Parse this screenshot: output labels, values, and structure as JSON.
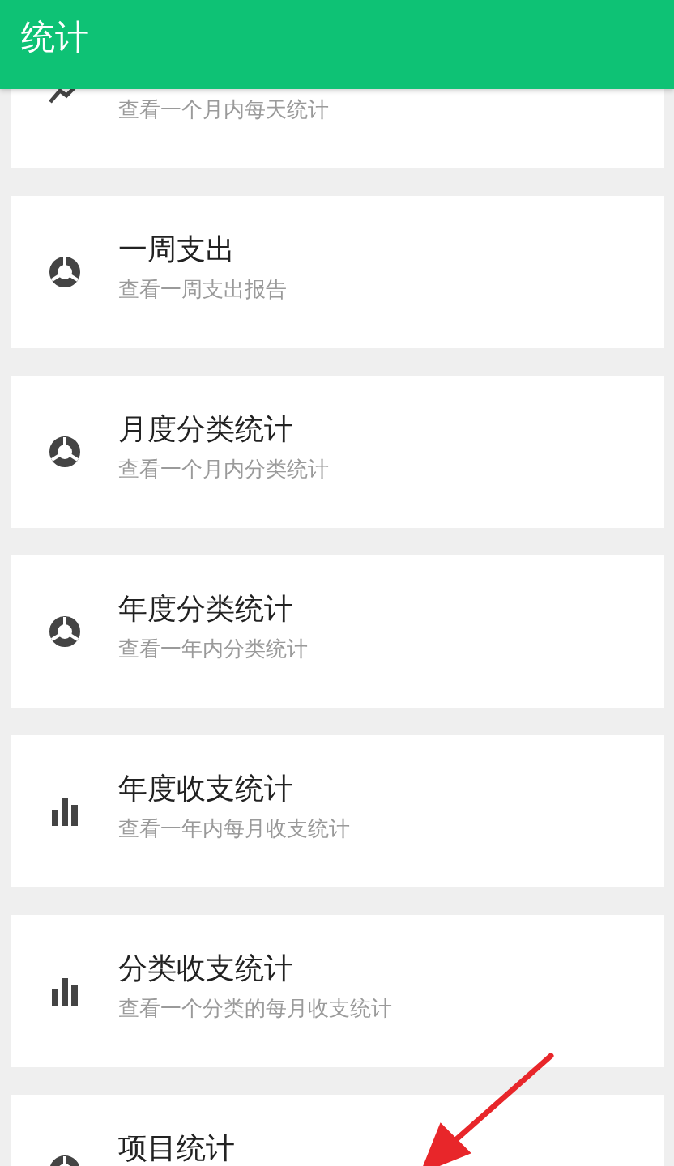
{
  "header": {
    "title": "统计"
  },
  "items": [
    {
      "kind": "trend",
      "subtitle": "查看一个月内每天统计"
    },
    {
      "kind": "pie",
      "title": "一周支出",
      "subtitle": "查看一周支出报告"
    },
    {
      "kind": "pie",
      "title": "月度分类统计",
      "subtitle": "查看一个月内分类统计"
    },
    {
      "kind": "pie",
      "title": "年度分类统计",
      "subtitle": "查看一年内分类统计"
    },
    {
      "kind": "bars",
      "title": "年度收支统计",
      "subtitle": "查看一年内每月收支统计"
    },
    {
      "kind": "bars",
      "title": "分类收支统计",
      "subtitle": "查看一个分类的每月收支统计"
    },
    {
      "kind": "pie",
      "title": "项目统计"
    }
  ]
}
